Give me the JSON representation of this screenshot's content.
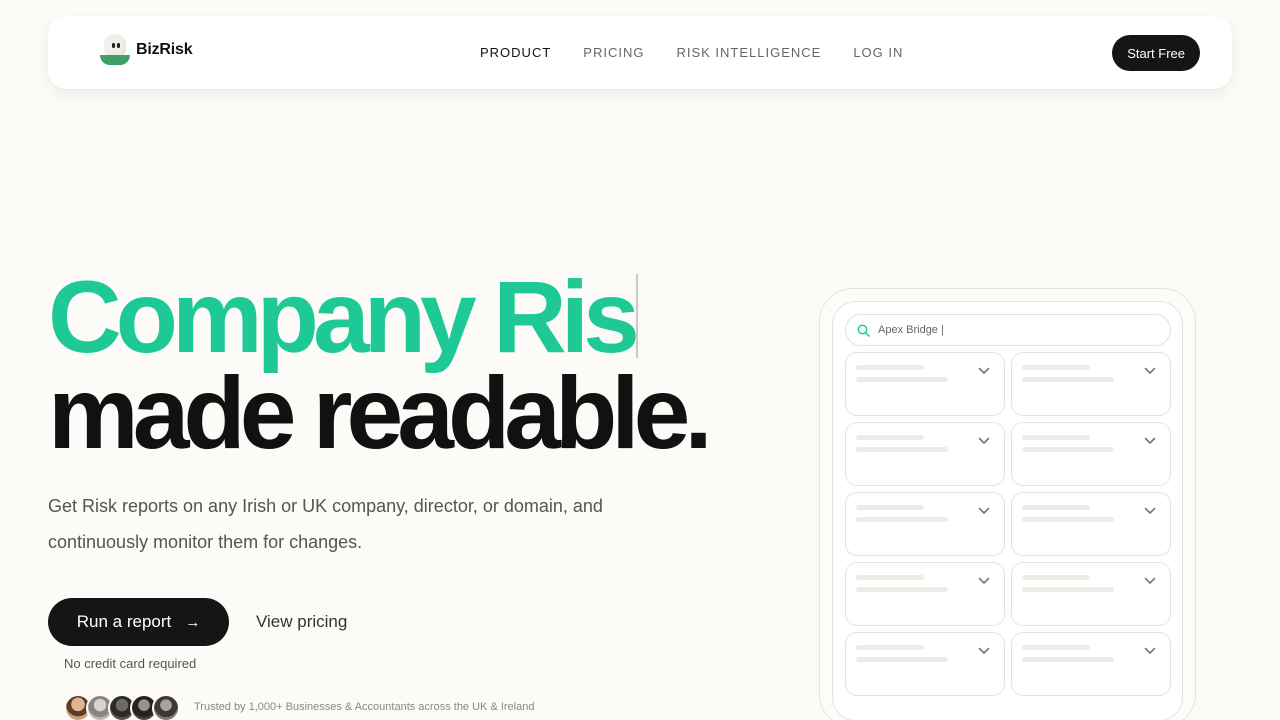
{
  "brand": {
    "name": "BizRisk",
    "logo_icon": "smiley-logo-icon"
  },
  "nav": {
    "links": [
      {
        "label": "PRODUCT",
        "active": true
      },
      {
        "label": "PRICING",
        "active": false
      },
      {
        "label": "RISK INTELLIGENCE",
        "active": false
      },
      {
        "label": "LOG IN",
        "active": false
      }
    ],
    "cta": "Start Free"
  },
  "hero": {
    "line1": "Company Ris",
    "line2": "made readable.",
    "subtitle": "Get Risk reports on any Irish or UK company, director, or domain, and continuously monitor them for changes.",
    "primary_cta": "Run a report",
    "primary_cta_icon": "arrow-right-icon",
    "secondary_cta": "View pricing",
    "note": "No credit card required",
    "trusted": "Trusted by 1,000+ Businesses & Accountants across the UK & Ireland",
    "avatar_count": 5
  },
  "mockup": {
    "search_value": "Apex Bridge |",
    "search_icon": "search-icon",
    "card_rows": 5,
    "card_cols": 2
  },
  "colors": {
    "accent": "#1ec996",
    "dark": "#151515",
    "background": "#fcfbf7",
    "logo_green": "#3fa065"
  }
}
